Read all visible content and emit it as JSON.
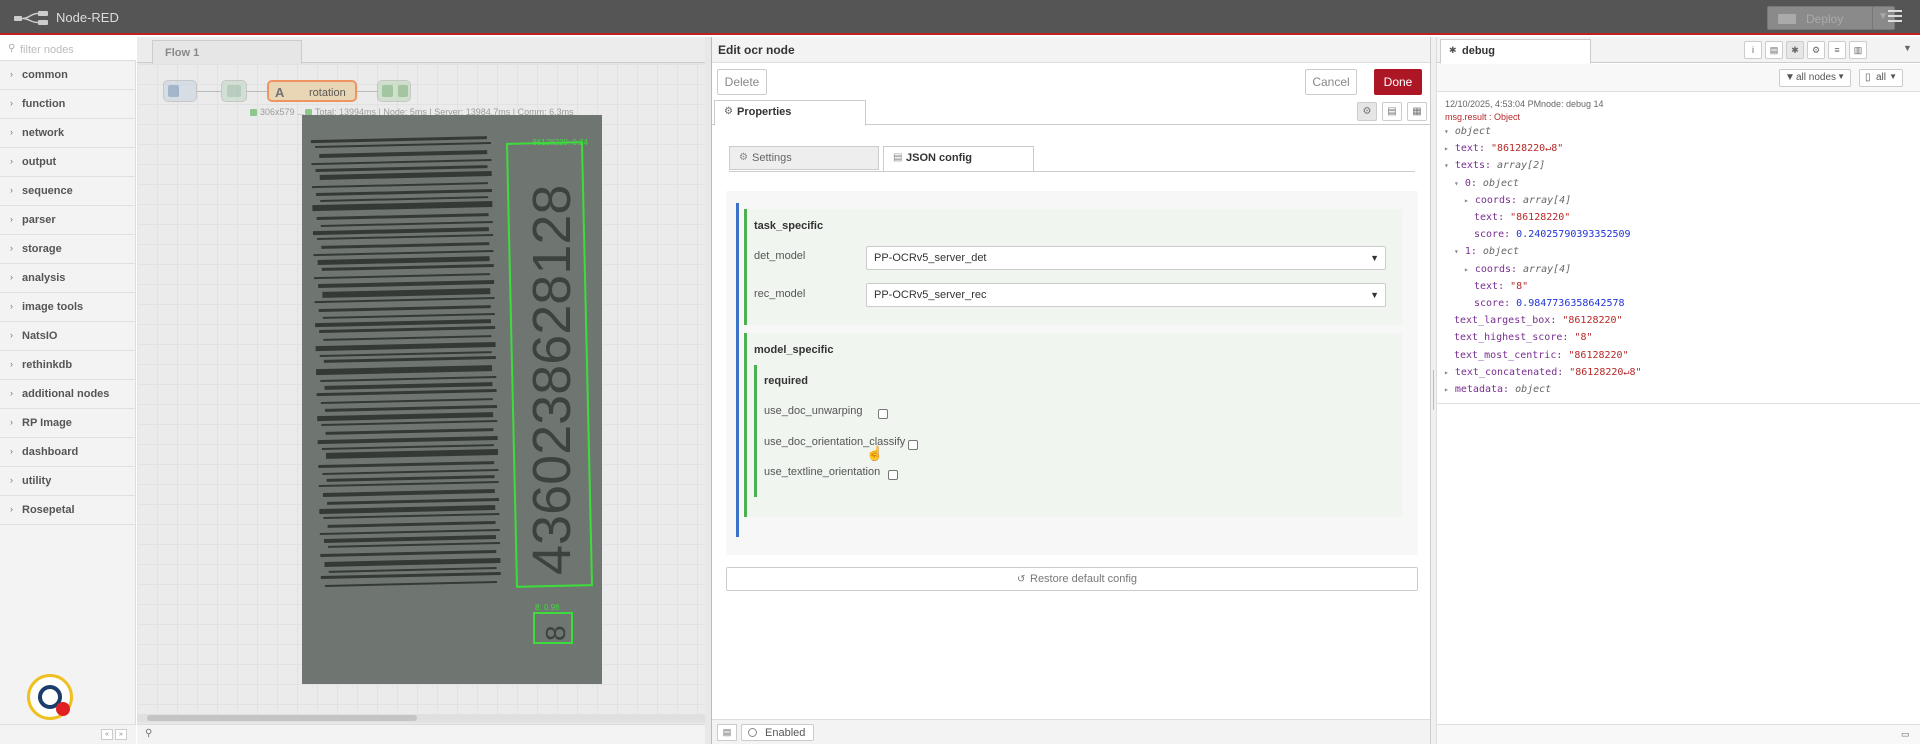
{
  "header": {
    "app_title": "Node-RED",
    "deploy_label": "Deploy"
  },
  "palette": {
    "filter_placeholder": "filter nodes",
    "categories": [
      "common",
      "function",
      "network",
      "output",
      "sequence",
      "parser",
      "storage",
      "analysis",
      "image tools",
      "NatsIO",
      "rethinkdb",
      "additional nodes",
      "RP Image",
      "dashboard",
      "utility",
      "Rosepetal"
    ]
  },
  "workspace": {
    "tab_label": "Flow 1",
    "nodes": {
      "rotation_label": "rotation"
    },
    "status": {
      "size": "306x579 ...",
      "timing": "Total: 13994ms | Node: 5ms | Server: 13984.7ms | Comm: 6.3ms"
    },
    "ocr_overlay": {
      "box1_label": "86128220: 0.24",
      "box1_digits": "4360238628128",
      "box2_label": "8: 0.98",
      "box2_digit": "8"
    }
  },
  "tray": {
    "title": "Edit ocr node",
    "delete_label": "Delete",
    "cancel_label": "Cancel",
    "done_label": "Done",
    "properties_tab": "Properties",
    "settings_tab": "Settings",
    "json_tab": "JSON config",
    "task_specific": {
      "title": "task_specific",
      "det_model_label": "det_model",
      "det_model_value": "PP-OCRv5_server_det",
      "rec_model_label": "rec_model",
      "rec_model_value": "PP-OCRv5_server_rec"
    },
    "model_specific": {
      "title": "model_specific",
      "required_title": "required",
      "options": [
        {
          "label": "use_doc_unwarping",
          "checked": false
        },
        {
          "label": "use_doc_orientation_classify",
          "checked": false
        },
        {
          "label": "use_textline_orientation",
          "checked": false
        }
      ]
    },
    "restore_label": "Restore default config",
    "enabled_label": "Enabled"
  },
  "sidebar": {
    "tab_label": "debug",
    "filter_nodes": "all nodes",
    "filter_all": "all",
    "message": {
      "date": "12/10/2025, 4:53:04 PM",
      "node": "node: debug 14",
      "path": "msg.result : Object",
      "lines": [
        {
          "tw": "▾",
          "key": "",
          "val": "object",
          "cls": "t"
        },
        {
          "tw": "▸",
          "key": "text: ",
          "val": "\"86128220↵8\"",
          "cls": "s"
        },
        {
          "tw": "▾",
          "key": "texts: ",
          "val": "array[2]",
          "cls": "t"
        },
        {
          "tw": "▾",
          "key": "0: ",
          "val": "object",
          "cls": "t"
        },
        {
          "tw": "▸",
          "key": "coords: ",
          "val": "array[4]",
          "cls": "t"
        },
        {
          "tw": "",
          "key": "text: ",
          "val": "\"86128220\"",
          "cls": "s"
        },
        {
          "tw": "",
          "key": "score: ",
          "val": "0.24025790393352509",
          "cls": "n"
        },
        {
          "tw": "▾",
          "key": "1: ",
          "val": "object",
          "cls": "t"
        },
        {
          "tw": "▸",
          "key": "coords: ",
          "val": "array[4]",
          "cls": "t"
        },
        {
          "tw": "",
          "key": "text: ",
          "val": "\"8\"",
          "cls": "s"
        },
        {
          "tw": "",
          "key": "score: ",
          "val": "0.9847736358642578",
          "cls": "n"
        },
        {
          "tw": "",
          "key": "text_largest_box: ",
          "val": "\"86128220\"",
          "cls": "s"
        },
        {
          "tw": "",
          "key": "text_highest_score: ",
          "val": "\"8\"",
          "cls": "s"
        },
        {
          "tw": "",
          "key": "text_most_centric: ",
          "val": "\"86128220\"",
          "cls": "s"
        },
        {
          "tw": "▸",
          "key": "text_concatenated: ",
          "val": "\"86128220↵8\"",
          "cls": "s"
        },
        {
          "tw": "▸",
          "key": "metadata: ",
          "val": "object",
          "cls": "t"
        }
      ]
    }
  },
  "colors": {
    "header_bg": "#555555",
    "accent_red": "#ad1625",
    "json_bar": "#3b73c9",
    "section_bar": "#4caf50"
  }
}
